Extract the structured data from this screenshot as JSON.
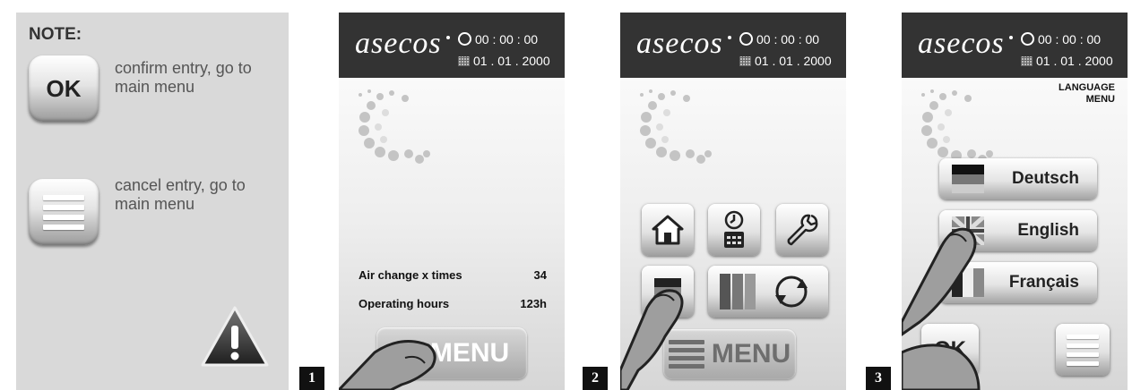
{
  "note": {
    "title": "NOTE:",
    "ok_label": "OK",
    "ok_desc": "confirm entry, go to main menu",
    "menu_desc": "cancel entry, go to main menu",
    "warning_icon": "warning-triangle-icon"
  },
  "device": {
    "logo": "asecos",
    "time": "00 : 00 : 00",
    "date": "01 . 01 . 2000"
  },
  "screen1": {
    "step": "1",
    "stats": [
      {
        "label": "Air change x times",
        "value": "34"
      },
      {
        "label": "Operating hours",
        "value": "123h"
      }
    ],
    "menu_label": "MENU"
  },
  "screen2": {
    "step": "2",
    "tiles": [
      "home-icon",
      "clock-calendar-icon",
      "wrench-icon",
      "language-flag-icon",
      "filter-rotate-icon"
    ],
    "menu_label": "MENU"
  },
  "screen3": {
    "step": "3",
    "heading_line1": "LANGUAGE",
    "heading_line2": "MENU",
    "languages": [
      "Deutsch",
      "English",
      "Français"
    ],
    "ok_label": "OK"
  },
  "colors": {
    "header": "#333333",
    "panel": "#d9d9d9"
  }
}
